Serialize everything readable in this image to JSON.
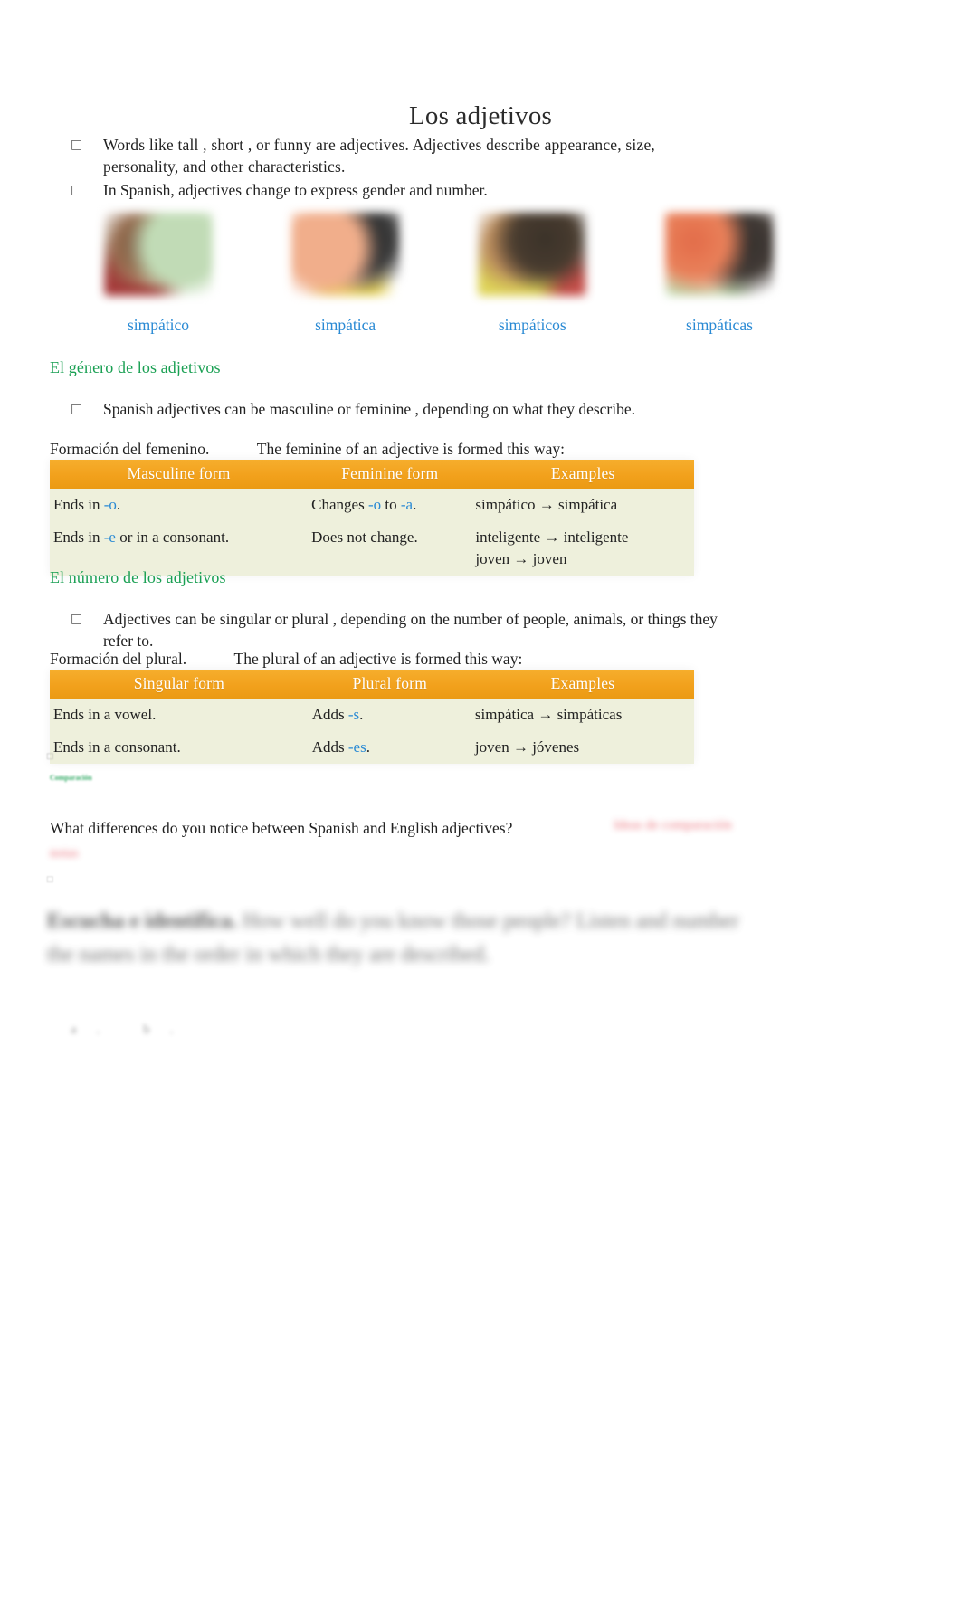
{
  "document": {
    "title": "Los adjetivos"
  },
  "intro": {
    "bullet_glyph": "□",
    "bullets": [
      "Words like    tall , short  , or  funny   are adjectives. Adjectives describe appearance, size, personality, and other characteristics.",
      "In Spanish, adjectives change to express gender and number."
    ]
  },
  "photos": [
    {
      "caption": "simpático",
      "alt_name": "photo-simpatico"
    },
    {
      "caption": "simpática",
      "alt_name": "photo-simpatica"
    },
    {
      "caption": "simpáticos",
      "alt_name": "photo-simpaticos"
    },
    {
      "caption": "simpáticas",
      "alt_name": "photo-simpaticas"
    }
  ],
  "gender_section": {
    "heading": "El género de los adjetivos",
    "bullet": "Spanish adjectives can be           masculine       or  feminine     , depending on what they describe.",
    "intro_spanish": "Formación del femenino.",
    "intro_english": "The feminine of an adjective is formed this way:",
    "table": {
      "headers": [
        "Masculine form",
        "Feminine form",
        "Examples"
      ],
      "rows": [
        {
          "masculine_prefix": "Ends in ",
          "masculine_hl": "-o",
          "masculine_suffix": ".",
          "feminine_prefix": "Changes ",
          "feminine_hl1": "-o",
          "feminine_mid": " to ",
          "feminine_hl2": "-a",
          "feminine_suffix": ".",
          "examples": [
            "simpático → simpática"
          ]
        },
        {
          "masculine_prefix": "Ends in ",
          "masculine_hl": "-e",
          "masculine_suffix": " or in a consonant.",
          "feminine_prefix": "Does not change.",
          "feminine_hl1": "",
          "feminine_mid": "",
          "feminine_hl2": "",
          "feminine_suffix": "",
          "examples": [
            "inteligente → inteligente",
            "joven → joven"
          ]
        }
      ]
    }
  },
  "number_section": {
    "heading": "El número de los adjetivos",
    "bullet": "Adjectives can be        singular      or  plural    , depending on the number of people, animals, or things they refer to.",
    "intro_spanish": "Formación del plural.",
    "intro_english": "The plural of an adjective is formed this way:",
    "table": {
      "headers": [
        "Singular form",
        "Plural form",
        "Examples"
      ],
      "rows": [
        {
          "singular": "Ends in a vowel.",
          "plural_prefix": "Adds ",
          "plural_hl": "-s",
          "plural_suffix": ".",
          "examples": [
            "simpática → simpáticas"
          ]
        },
        {
          "singular": "Ends in a consonant.",
          "plural_prefix": "Adds ",
          "plural_hl": "-es",
          "plural_suffix": ".",
          "examples": [
            "joven → jóvenes"
          ]
        }
      ]
    }
  },
  "footer": {
    "faded_label": "Comparación",
    "tiny_mark": "□",
    "question": "What differences do you notice between Spanish and English adjectives?",
    "redacted_right": "Ideas de comparación",
    "redacted_left": "notas",
    "tiny_mark_2": "□",
    "exercise_title": "Escucha e identifica.",
    "exercise_body": " How well do you know those people? Listen and number the names in the order in which they are described.",
    "exercise_items": "a. b."
  },
  "colors": {
    "accent_blue": "#2a8ad4",
    "heading_green": "#1aa053",
    "table_header_orange": "#f2a11c",
    "table_body_green": "#eef0dc",
    "redaction_red": "#e8606a"
  }
}
